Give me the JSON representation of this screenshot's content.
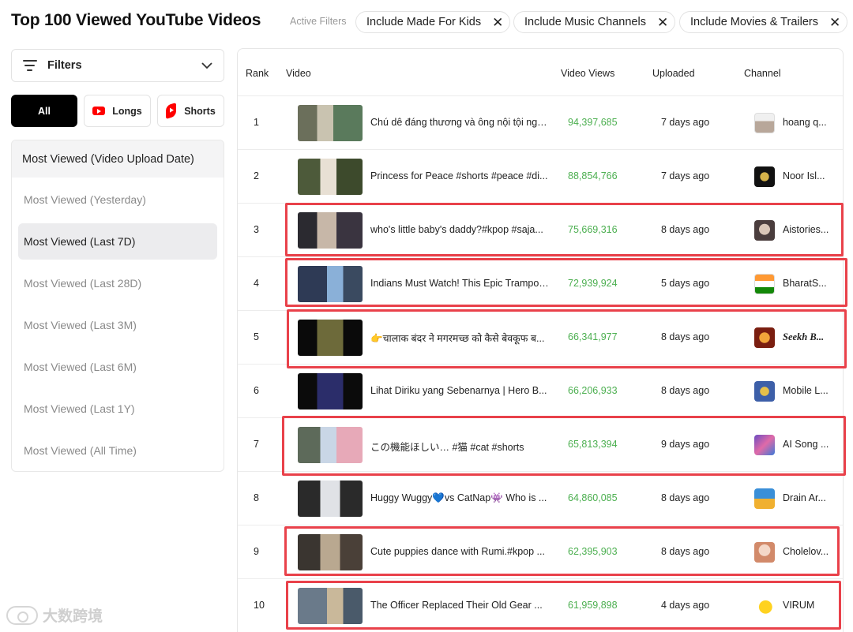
{
  "page": {
    "title": "Top 100 Viewed YouTube Videos",
    "active_filters_label": "Active Filters",
    "active_filters": [
      {
        "label": "Include Made For Kids",
        "close": "✕"
      },
      {
        "label": "Include Music Channels",
        "close": "✕"
      },
      {
        "label": "Include Movies & Trailers",
        "close": "✕"
      }
    ]
  },
  "sidebar": {
    "filters_label": "Filters",
    "filters_chevron": "⌄",
    "types": [
      {
        "label": "All",
        "icon": null
      },
      {
        "label": "Longs",
        "icon": "youtube-icon"
      },
      {
        "label": "Shorts",
        "icon": "shorts-icon"
      }
    ],
    "period_header": "Most Viewed (Video Upload Date)",
    "periods": [
      "Most Viewed (Yesterday)",
      "Most Viewed (Last 7D)",
      "Most Viewed (Last 28D)",
      "Most Viewed (Last 3M)",
      "Most Viewed (Last 6M)",
      "Most Viewed (Last 1Y)",
      "Most Viewed (All Time)"
    ],
    "selected_period": "Most Viewed (Last 7D)"
  },
  "table": {
    "headers": {
      "rank": "Rank",
      "video": "Video",
      "views": "Video Views",
      "uploaded": "Uploaded",
      "channel": "Channel"
    },
    "rows": [
      {
        "rank": "1",
        "title": "Chú dê đáng thương và ông nội tội nghiệp",
        "views": "94,397,685",
        "uploaded": "7 days ago",
        "channel": "hoang q...",
        "highlighted": false
      },
      {
        "rank": "2",
        "title": "Princess for Peace #shorts #peace #di...",
        "views": "88,854,766",
        "uploaded": "7 days ago",
        "channel": "Noor Isl...",
        "highlighted": false
      },
      {
        "rank": "3",
        "title": "who's little baby's daddy?#kpop #saja...",
        "views": "75,669,316",
        "uploaded": "8 days ago",
        "channel": "Aistories...",
        "highlighted": true
      },
      {
        "rank": "4",
        "title": "Indians Must Watch! This Epic Trampol...",
        "views": "72,939,924",
        "uploaded": "5 days ago",
        "channel": "BharatS...",
        "highlighted": true
      },
      {
        "rank": "5",
        "title": "👉चालाक बंदर ने मगरमच्छ को कैसे बेवकूफ ब...",
        "views": "66,341,977",
        "uploaded": "8 days ago",
        "channel": "Seekh B...",
        "highlighted": true
      },
      {
        "rank": "6",
        "title": "Lihat Diriku yang Sebenarnya | Hero B...",
        "views": "66,206,933",
        "uploaded": "8 days ago",
        "channel": "Mobile L...",
        "highlighted": false
      },
      {
        "rank": "7",
        "title": "この機能ほしい… #猫 #cat #shorts",
        "views": "65,813,394",
        "uploaded": "9 days ago",
        "channel": "AI Song ...",
        "highlighted": true
      },
      {
        "rank": "8",
        "title": "Huggy Wuggy💙vs CatNap👾 Who is ...",
        "views": "64,860,085",
        "uploaded": "8 days ago",
        "channel": "Drain Ar...",
        "highlighted": false
      },
      {
        "rank": "9",
        "title": "Cute puppies dance with Rumi.#kpop ...",
        "views": "62,395,903",
        "uploaded": "8 days ago",
        "channel": "Cholelov...",
        "highlighted": true
      },
      {
        "rank": "10",
        "title": "The Officer Replaced Their Old Gear ...",
        "views": "61,959,898",
        "uploaded": "4 days ago",
        "channel": "VIRUM",
        "highlighted": true
      }
    ]
  },
  "watermark": "大数跨境",
  "colors": {
    "views_green": "#4caf50",
    "highlight_red": "#e9414a",
    "youtube_red": "#ff0000"
  }
}
